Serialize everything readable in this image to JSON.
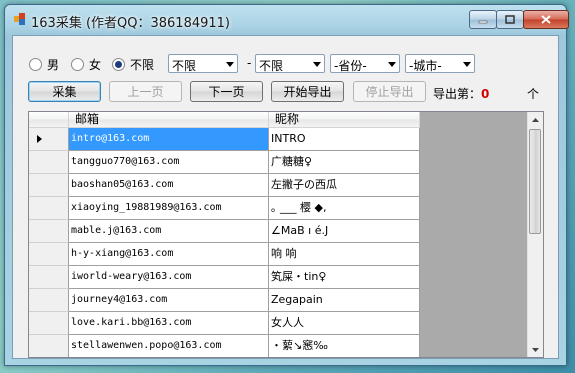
{
  "window": {
    "title": "163采集    (作者QQ：386184911)"
  },
  "filters": {
    "gender": [
      {
        "label": "男",
        "checked": false
      },
      {
        "label": "女",
        "checked": false
      },
      {
        "label": "不限",
        "checked": true
      }
    ],
    "age_from": "不限",
    "separator": "-",
    "age_to": "不限",
    "province": "-省份-",
    "city": "-城市-"
  },
  "toolbar": {
    "collect": "采集",
    "prev": "上一页",
    "next": "下一页",
    "start_export": "开始导出",
    "stop_export": "停止导出",
    "export_label": "导出第：",
    "export_count": "0",
    "export_unit": "个"
  },
  "grid": {
    "columns": [
      "邮箱",
      "昵称"
    ],
    "rows": [
      {
        "email": "intro@163.com",
        "nick": "INTRO"
      },
      {
        "email": "tangguo770@163.com",
        "nick": "广糖糖♀"
      },
      {
        "email": "baoshan05@163.com",
        "nick": "左撇子の西瓜"
      },
      {
        "email": "xiaoying_19881989@163.com",
        "nick": "｡ ___ 樱 ◆,"
      },
      {
        "email": "mable.j@163.com",
        "nick": "∠MaB ı é.J"
      },
      {
        "email": "h-y-xiang@163.com",
        "nick": "响 响"
      },
      {
        "email": "iworld-weary@163.com",
        "nick": "笂屎・tin♀"
      },
      {
        "email": "journey4@163.com",
        "nick": "Zegapain"
      },
      {
        "email": "love.kari.bb@163.com",
        "nick": "女人人"
      },
      {
        "email": "stellawenwen.popo@163.com",
        "nick": "・蕠↘窸‰"
      }
    ]
  },
  "colors": {
    "accent": "#3399ff",
    "count": "#d00000"
  }
}
